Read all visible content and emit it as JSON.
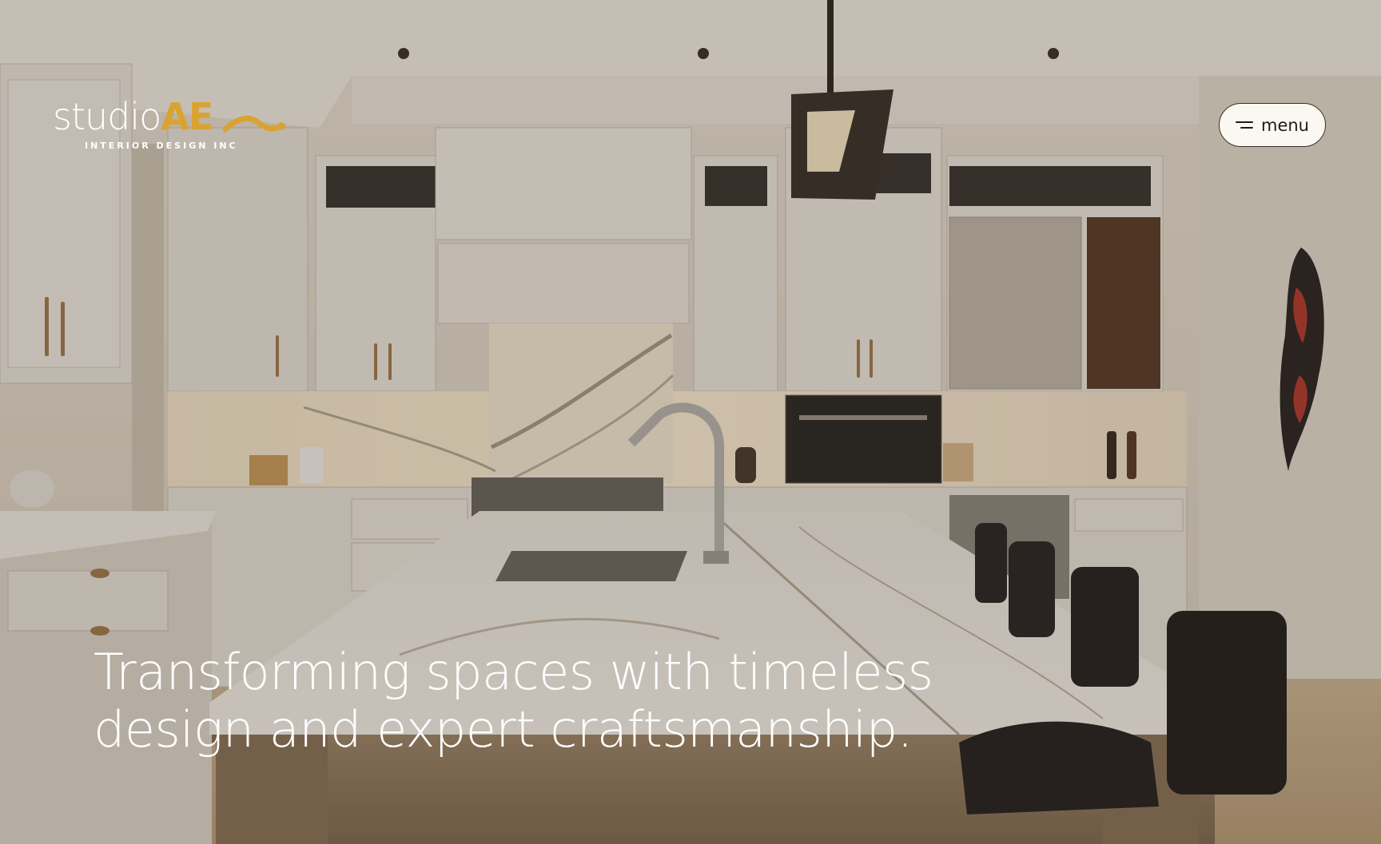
{
  "logo": {
    "studio": "studio",
    "ae": "AE",
    "tagline": "INTERIOR DESIGN INC",
    "accent_color": "#d9a332"
  },
  "nav": {
    "menu_label": "menu",
    "menu_icon": "hamburger-icon"
  },
  "hero": {
    "image_subject": "kitchen-interior-photo",
    "headline_line1": "Transforming spaces with timeless",
    "headline_line2": "design and expert craftsmanship."
  },
  "colors": {
    "menu_button_bg": "#fbf8f2",
    "headline": "#ffffff"
  }
}
